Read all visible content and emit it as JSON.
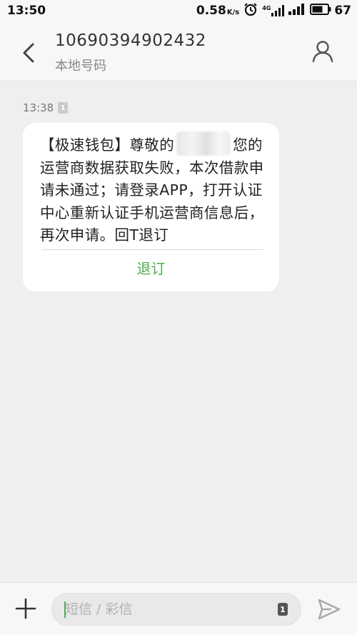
{
  "status_bar": {
    "time": "13:50",
    "speed": "0.58",
    "speed_unit": "K/s",
    "network": "4G",
    "battery": "67"
  },
  "header": {
    "number": "10690394902432",
    "subtitle": "本地号码"
  },
  "message": {
    "time": "13:38",
    "sim_slot": "1",
    "text_before": "【极速钱包】尊敬的",
    "text_after": "您的运营商数据获取失败，本次借款申请未通过；请登录APP，打开认证中心重新认证手机运营商信息后，再次申请。回T退订",
    "action_label": "退订"
  },
  "composer": {
    "placeholder": "短信 / 彩信",
    "sim_slot": "1"
  },
  "colors": {
    "accent": "#4caf50",
    "background": "#efefef",
    "bubble": "#ffffff"
  }
}
